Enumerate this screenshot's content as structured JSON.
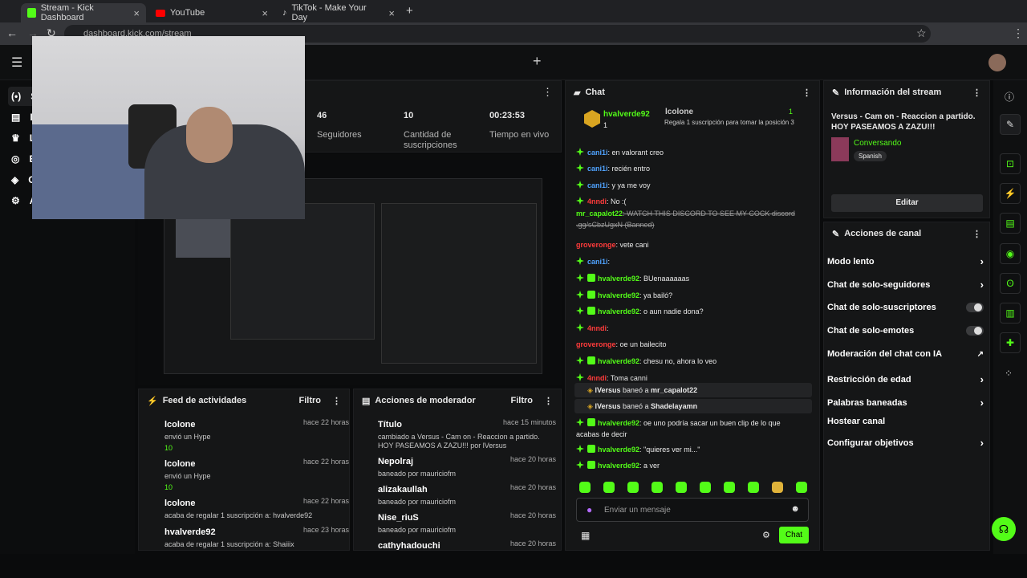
{
  "browser": {
    "tabs": [
      {
        "title": "Stream - Kick Dashboard"
      },
      {
        "title": "YouTube"
      },
      {
        "title": "TikTok - Make Your Day"
      }
    ],
    "url": "dashboard.kick.com/stream"
  },
  "stats": [
    {
      "value": "46",
      "label": "Seguidores"
    },
    {
      "value": "10",
      "label": "Cantidad de suscripciones"
    },
    {
      "value": "00:23:53",
      "label": "Tiempo en vivo"
    }
  ],
  "nav": {
    "items": [
      {
        "label": "S"
      },
      {
        "label": "I"
      },
      {
        "label": "L"
      },
      {
        "label": "E"
      },
      {
        "label": "C"
      },
      {
        "label": "A"
      }
    ]
  },
  "feed": {
    "title": "Feed de actividades",
    "filter": "Filtro",
    "items": [
      {
        "name": "lcolone",
        "time": "hace 22 horas",
        "line": "envió un Hype",
        "amount": "10"
      },
      {
        "name": "lcolone",
        "time": "hace 22 horas",
        "line": "envió un Hype",
        "amount": "10"
      },
      {
        "name": "lcolone",
        "time": "hace 22 horas",
        "line": "acaba de regalar 1 suscripción a: hvalverde92"
      },
      {
        "name": "hvalverde92",
        "time": "hace 23 horas",
        "line": "acaba de regalar 1 suscripción a: Shaiiix"
      }
    ]
  },
  "mod": {
    "title": "Acciones de moderador",
    "filter": "Filtro",
    "items": [
      {
        "name": "Título",
        "time": "hace 15 minutos",
        "line": "cambiado a Versus - Cam on - Reaccion a partido. HOY PASEAMOS A ZAZU!!! por lVersus"
      },
      {
        "name": "Nepolraj",
        "time": "hace 20 horas",
        "line": "baneado por mauriciofm"
      },
      {
        "name": "alizakaullah",
        "time": "hace 20 horas",
        "line": "baneado por mauriciofm"
      },
      {
        "name": "Nise_riuS",
        "time": "hace 20 horas",
        "line": "baneado por mauriciofm"
      },
      {
        "name": "cathyhadouchi",
        "time": "hace 20 horas",
        "line": ""
      }
    ]
  },
  "chat": {
    "title": "Chat",
    "top": {
      "first_name": "hvalverde92",
      "first_rank": "1",
      "second_name": "lcolone",
      "second_count": "1",
      "promo": "Regala 1 suscripción para tomar la posición 3"
    },
    "messages": [
      {
        "user": "cani1i",
        "text": ": en valorant creo",
        "color": "#4fa3ff"
      },
      {
        "user": "cani1i",
        "text": ": recién entro",
        "color": "#4fa3ff"
      },
      {
        "user": "cani1i",
        "text": ": y ya me voy",
        "color": "#4fa3ff"
      },
      {
        "user": "4nndi",
        "text": ": No :(",
        "color": "#ff3b3b"
      },
      {
        "user": "mr_capalot22",
        "text": ": WATCH THIS DISCORD TO SEE MY COCK discord .gg/sCbzUgxN (Banned)",
        "color": "#53fc18"
      },
      {
        "user": "groveronge",
        "text": ": vete cani",
        "color": "#ff3b3b"
      },
      {
        "user": "cani1i",
        "text": ":",
        "color": "#4fa3ff"
      },
      {
        "user": "hvalverde92",
        "text": ": BUenaaaaaas",
        "color": "#53fc18"
      },
      {
        "user": "hvalverde92",
        "text": ": ya bailó?",
        "color": "#53fc18"
      },
      {
        "user": "hvalverde92",
        "text": ": o aun nadie dona?",
        "color": "#53fc18"
      },
      {
        "user": "4nndi",
        "text": ":",
        "color": "#ff3b3b"
      },
      {
        "user": "groveronge",
        "text": ": oe un bailecito",
        "color": "#ff3b3b"
      },
      {
        "user": "hvalverde92",
        "text": ": chesu no, ahora lo veo",
        "color": "#53fc18"
      },
      {
        "user": "4nndi",
        "text": ": Toma canni",
        "color": "#ff3b3b"
      }
    ],
    "system": [
      {
        "mod": "lVersus",
        "action": "baneó a",
        "target": "mr_capalot22"
      },
      {
        "mod": "lVersus",
        "action": "baneó a",
        "target": "Shadelayamn"
      }
    ],
    "messages2": [
      {
        "user": "hvalverde92",
        "text": ": oe uno podría sacar un buen clip de lo que acabas de decir",
        "color": "#53fc18"
      },
      {
        "user": "hvalverde92",
        "text": ": \"quieres ver mi...\"",
        "color": "#53fc18"
      },
      {
        "user": "hvalverde92",
        "text": ": a ver",
        "color": "#53fc18"
      }
    ],
    "input_placeholder": "Enviar un mensaje",
    "send_label": "Chat"
  },
  "info": {
    "title": "Información del stream",
    "stream_title": "Versus - Cam on - Reaccion a partido. HOY PASEAMOS A ZAZU!!!",
    "category": "Conversando",
    "language": "Spanish",
    "edit_label": "Editar"
  },
  "actions": {
    "title": "Acciones de canal",
    "items": [
      {
        "label": "Modo lento",
        "control": "chevron"
      },
      {
        "label": "Chat de solo-seguidores",
        "control": "chevron"
      },
      {
        "label": "Chat de solo-suscriptores",
        "control": "toggle"
      },
      {
        "label": "Chat de solo-emotes",
        "control": "toggle"
      },
      {
        "label": "Moderación del chat con IA",
        "control": "external"
      },
      {
        "label": "Restricción de edad",
        "control": "chevron"
      },
      {
        "label": "Palabras baneadas",
        "control": "chevron"
      },
      {
        "label": "Hostear canal",
        "control": "none"
      },
      {
        "label": "Configurar objetivos",
        "control": "chevron"
      }
    ]
  },
  "colors": {
    "accent": "#53fc18",
    "bg": "#0a0b0c",
    "panel": "#151617"
  }
}
